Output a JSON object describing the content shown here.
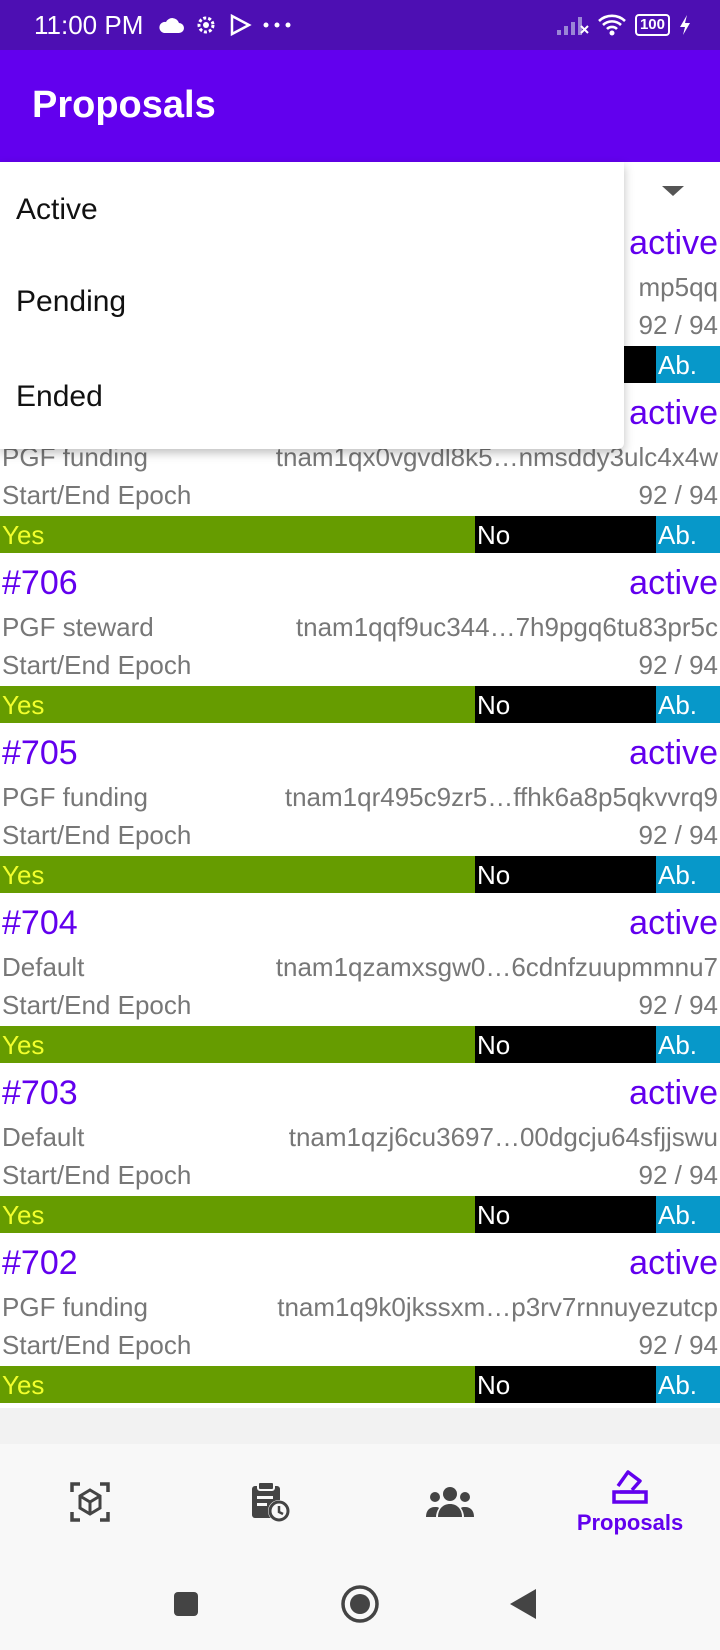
{
  "status_bar": {
    "time": "11:00 PM",
    "battery": "100",
    "icons_left": [
      "cloud-icon",
      "settings-icon",
      "play-icon",
      "more-icon"
    ],
    "icons_right": [
      "signal-icon",
      "wifi-icon",
      "battery-icon",
      "charging-icon"
    ]
  },
  "app_bar": {
    "title": "Proposals"
  },
  "filter_menu": {
    "items": [
      "Active",
      "Pending",
      "Ended"
    ]
  },
  "colors": {
    "primary": "#6200ee",
    "yes": "#669c00",
    "yes_text": "#f2ff2b",
    "no": "#000000",
    "abstain": "#0798c9"
  },
  "vote_labels": {
    "yes": "Yes",
    "no": "No",
    "abstain": "Ab."
  },
  "proposals": [
    {
      "id": "",
      "status": "active",
      "type": "",
      "author": "mp5qq",
      "epoch_label": "",
      "epoch": "92 / 94"
    },
    {
      "id": "",
      "status": "active",
      "type": "PGF funding",
      "author": "tnam1qx0vgvdl8k5…nmsddy3ulc4x4w",
      "epoch_label": "Start/End Epoch",
      "epoch": "92 / 94"
    },
    {
      "id": "#706",
      "status": "active",
      "type": "PGF steward",
      "author": "tnam1qqf9uc344…7h9pgq6tu83pr5c",
      "epoch_label": "Start/End Epoch",
      "epoch": "92 / 94"
    },
    {
      "id": "#705",
      "status": "active",
      "type": "PGF funding",
      "author": "tnam1qr495c9zr5…ffhk6a8p5qkvvrq9",
      "epoch_label": "Start/End Epoch",
      "epoch": "92 / 94"
    },
    {
      "id": "#704",
      "status": "active",
      "type": "Default",
      "author": "tnam1qzamxsgw0…6cdnfzuupmmnu7",
      "epoch_label": "Start/End Epoch",
      "epoch": "92 / 94"
    },
    {
      "id": "#703",
      "status": "active",
      "type": "Default",
      "author": "tnam1qzj6cu3697…00dgcju64sfjjswu",
      "epoch_label": "Start/End Epoch",
      "epoch": "92 / 94"
    },
    {
      "id": "#702",
      "status": "active",
      "type": "PGF funding",
      "author": "tnam1q9k0jkssxm…p3rv7rnnuyezutcp",
      "epoch_label": "Start/End Epoch",
      "epoch": "92 / 94"
    }
  ],
  "bottom_nav": {
    "items": [
      {
        "icon": "cube-scan-icon",
        "label": ""
      },
      {
        "icon": "calendar-clock-icon",
        "label": ""
      },
      {
        "icon": "people-icon",
        "label": ""
      },
      {
        "icon": "ballot-box-icon",
        "label": "Proposals"
      }
    ]
  },
  "system_nav": [
    "recents-button",
    "home-button",
    "back-button"
  ]
}
